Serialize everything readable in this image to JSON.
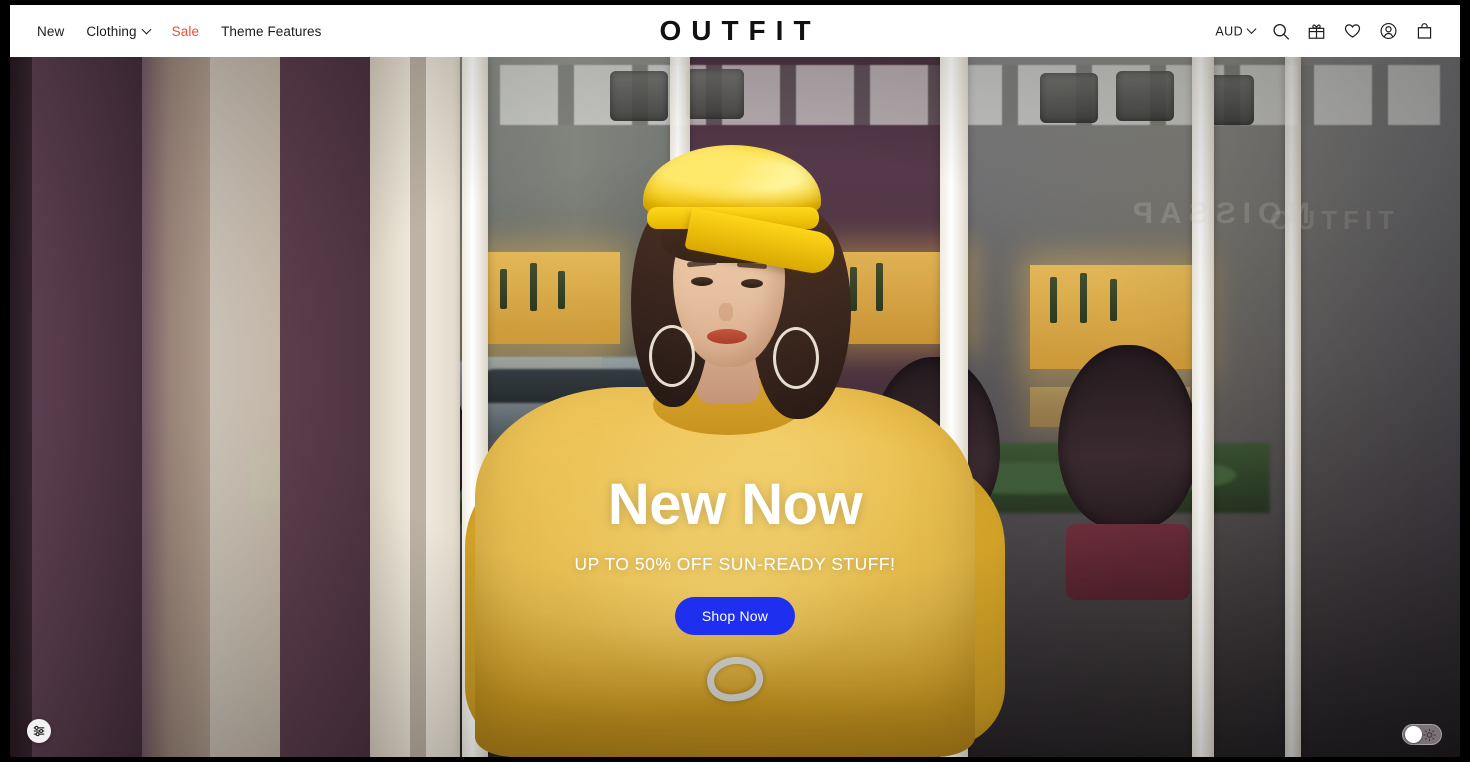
{
  "header": {
    "logo": "OUTFIT",
    "nav": [
      {
        "label": "New",
        "kind": "plain",
        "name": "nav-new"
      },
      {
        "label": "Clothing",
        "kind": "dropdown",
        "name": "nav-clothing"
      },
      {
        "label": "Sale",
        "kind": "sale",
        "name": "nav-sale"
      },
      {
        "label": "Theme Features",
        "kind": "plain",
        "name": "nav-theme-features"
      }
    ],
    "currency": {
      "value": "AUD"
    },
    "icons": [
      {
        "name": "search-icon",
        "label": "Search"
      },
      {
        "name": "gift-icon",
        "label": "Gift"
      },
      {
        "name": "heart-icon",
        "label": "Wishlist"
      },
      {
        "name": "account-icon",
        "label": "Account"
      },
      {
        "name": "shopping-bag-icon",
        "label": "Cart"
      }
    ]
  },
  "hero": {
    "title": "New Now",
    "subtitle": "UP TO 50% OFF SUN-READY STUFF!",
    "cta_label": "Shop Now",
    "sign_left": "NOISSAP",
    "sign_right": "OUTFIT"
  },
  "widgets": {
    "accessibility": {
      "name": "accessibility-widget",
      "label": "Accessibility options"
    },
    "theme_toggle": {
      "name": "theme-toggle",
      "label": "Light mode",
      "state": "light"
    }
  },
  "colors": {
    "accent_blue": "#1f2ff0",
    "sale_red": "#e8503a",
    "logo_black": "#111111",
    "hero_yellow": "#e8b53a"
  }
}
